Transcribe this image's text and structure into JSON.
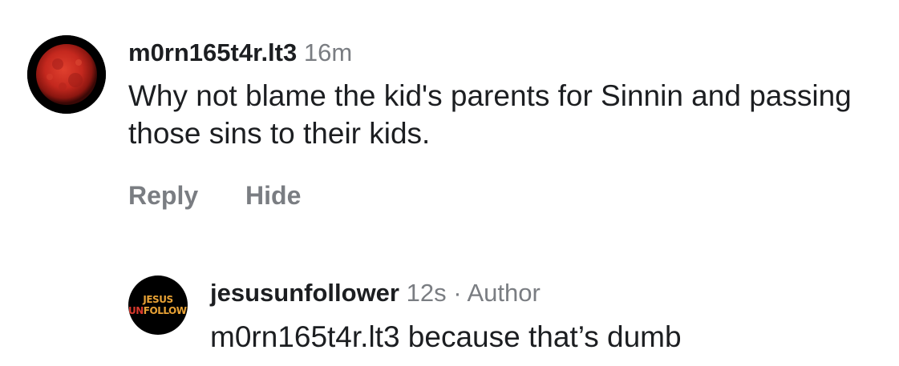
{
  "comments": [
    {
      "username": "m0rn165t4r.lt3",
      "time": "16m",
      "text": "Why not blame the kid's parents for Sinnin and passing those sins to their kids.",
      "actions": {
        "reply": "Reply",
        "hide": "Hide"
      },
      "avatar": {
        "icon": "blood-moon-icon"
      }
    },
    {
      "username": "jesusunfollower",
      "time": "12s",
      "separator": "·",
      "role": "Author",
      "text": "m0rn165t4r.lt3 because that’s dumb",
      "avatar": {
        "icon": "jesus-unfollower-logo",
        "logo_line1": "JESUS",
        "logo_line2_prefix": "UN",
        "logo_line2_rest": "FOLLOWER"
      }
    }
  ],
  "colors": {
    "text": "#1c1e21",
    "meta": "#7a7d82",
    "background": "#ffffff",
    "logo_orange": "#e8a235",
    "logo_red": "#d8382c",
    "moon_red": "#c4281e"
  }
}
